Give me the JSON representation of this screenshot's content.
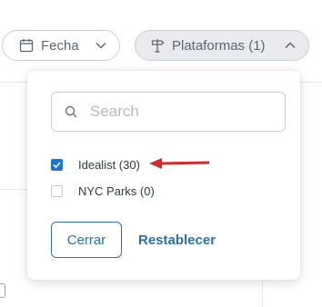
{
  "filters": {
    "fecha": {
      "label": "Fecha",
      "icon": "calendar-icon"
    },
    "plataformas": {
      "label": "Plataformas (1)",
      "icon": "signpost-icon",
      "expanded": true
    }
  },
  "dropdown": {
    "search": {
      "placeholder": "Search",
      "value": ""
    },
    "options": [
      {
        "label": "Idealist (30)",
        "checked": true
      },
      {
        "label": "NYC Parks (0)",
        "checked": false
      }
    ],
    "close_label": "Cerrar",
    "reset_label": "Restablecer"
  },
  "colors": {
    "accent": "#1877d2",
    "link": "#2a6fa8",
    "annotation_arrow": "#d32a2a",
    "chip_active_bg": "#e8eaed"
  }
}
